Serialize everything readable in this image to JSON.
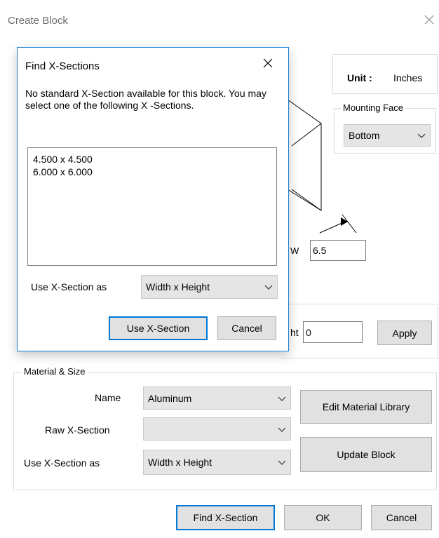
{
  "main_dialog": {
    "title": "Create Block",
    "unit_label": "Unit :",
    "unit_value": "Inches",
    "mounting_face": {
      "label": "Mounting Face",
      "value": "Bottom"
    },
    "w_label": "W",
    "w_value": "6.5",
    "height_label_partial": "ht",
    "height_value": "0",
    "apply_label": "Apply",
    "material_size": {
      "group_label": "Material & Size",
      "name_label": "Name",
      "name_value": "Aluminum",
      "raw_xsection_label": "Raw X-Section",
      "raw_xsection_value": "",
      "use_xsection_label": "Use X-Section as",
      "use_xsection_value": "Width x Height",
      "edit_material_library_label": "Edit Material Library",
      "update_block_label": "Update Block"
    },
    "footer": {
      "find_xsection_label": "Find X-Section",
      "ok_label": "OK",
      "cancel_label": "Cancel"
    }
  },
  "popup": {
    "title": "Find X-Sections",
    "message": "No standard X-Section available for this block. You may select one of the following X -Sections.",
    "options": [
      "4.500 x 4.500",
      "6.000 x 6.000"
    ],
    "use_as_label": "Use X-Section as",
    "use_as_value": "Width x Height",
    "use_button_label": "Use X-Section",
    "cancel_label": "Cancel"
  }
}
